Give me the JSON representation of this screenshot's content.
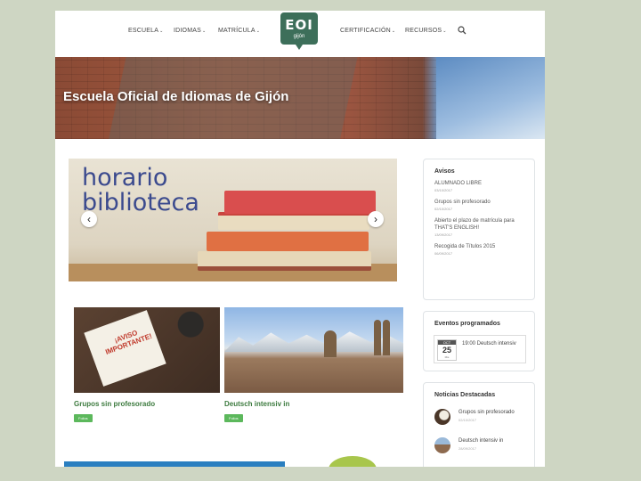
{
  "nav": {
    "left": [
      {
        "label": "Escuela"
      },
      {
        "label": "Idiomas"
      },
      {
        "label": "Matrícula"
      }
    ],
    "right": [
      {
        "label": "Certificación"
      },
      {
        "label": "Recursos"
      }
    ],
    "logo": {
      "main": "EOI",
      "sub": "gijón"
    }
  },
  "hero": {
    "title": "Escuela Oficial de Idiomas de Gijón"
  },
  "slider": {
    "line1": "horario",
    "line2": "biblioteca"
  },
  "cards": [
    {
      "title": "Grupos sin profesorado",
      "tag": "Folios",
      "note": "¡AVISO IMPORTANTE!"
    },
    {
      "title": "Deutsch intensiv in",
      "tag": "Folios"
    }
  ],
  "avisos": {
    "title": "Avisos",
    "items": [
      {
        "title": "ALUMNADO LIBRE",
        "date": "03/10/2017"
      },
      {
        "title": "Grupos sin profesorado",
        "date": "02/10/2017"
      },
      {
        "title": "Abierto el plazo de matrícula para THAT'S ENGLISH!",
        "date": "13/09/2017"
      },
      {
        "title": "Recogida de Títulos 2015",
        "date": "06/09/2017"
      }
    ]
  },
  "eventos": {
    "title": "Eventos programados",
    "event": {
      "month": "OCT",
      "day": "25",
      "year": "Mie",
      "text": "19:00 Deutsch intensiv"
    }
  },
  "noticias": {
    "title": "Noticias Destacadas",
    "items": [
      {
        "title": "Grupos sin profesorado",
        "date": "02/10/2017"
      },
      {
        "title": "Deutsch intensiv in",
        "date": "28/09/2017"
      }
    ]
  },
  "colors": {
    "brand": "#3d6f5a",
    "accent_green": "#5cb85c",
    "title_green": "#3d7b3f",
    "slider_text": "#3b4a8e"
  }
}
